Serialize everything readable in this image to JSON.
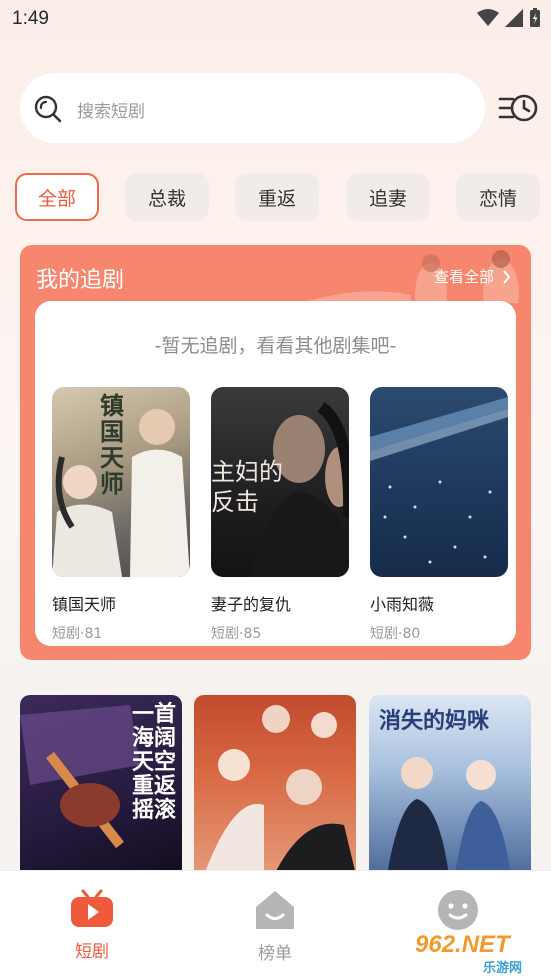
{
  "status_bar": {
    "time": "1:49"
  },
  "search": {
    "placeholder": "搜索短剧"
  },
  "categories": [
    "全部",
    "总裁",
    "重返",
    "追妻",
    "恋情"
  ],
  "follow": {
    "title": "我的追剧",
    "view_all": "查看全部",
    "empty_text": "-暂无追剧，看看其他剧集吧-",
    "recommendations": [
      {
        "name": "镇国天师",
        "meta": "短剧·81",
        "poster_text": "镇国天师"
      },
      {
        "name": "妻子的复仇",
        "meta": "短剧·85",
        "poster_text": "主妇的反击"
      },
      {
        "name": "小雨知薇",
        "meta": "短剧·80",
        "poster_text": ""
      }
    ]
  },
  "grid": [
    {
      "poster_text": "一首海阔天空 重返摇滚"
    },
    {
      "poster_text": ""
    },
    {
      "poster_text": "消失的妈咪"
    }
  ],
  "bottom_nav": [
    {
      "label": "短剧",
      "icon": "tv-icon",
      "active": true
    },
    {
      "label": "榜单",
      "icon": "home-smile-icon",
      "active": false
    },
    {
      "label": "",
      "icon": "face-icon",
      "active": false
    }
  ],
  "watermark": {
    "text": "962.NET",
    "subtext": "乐游网"
  },
  "colors": {
    "accent": "#ef5a3c",
    "card": "#f6876e",
    "inactive": "#b5b5b5"
  }
}
